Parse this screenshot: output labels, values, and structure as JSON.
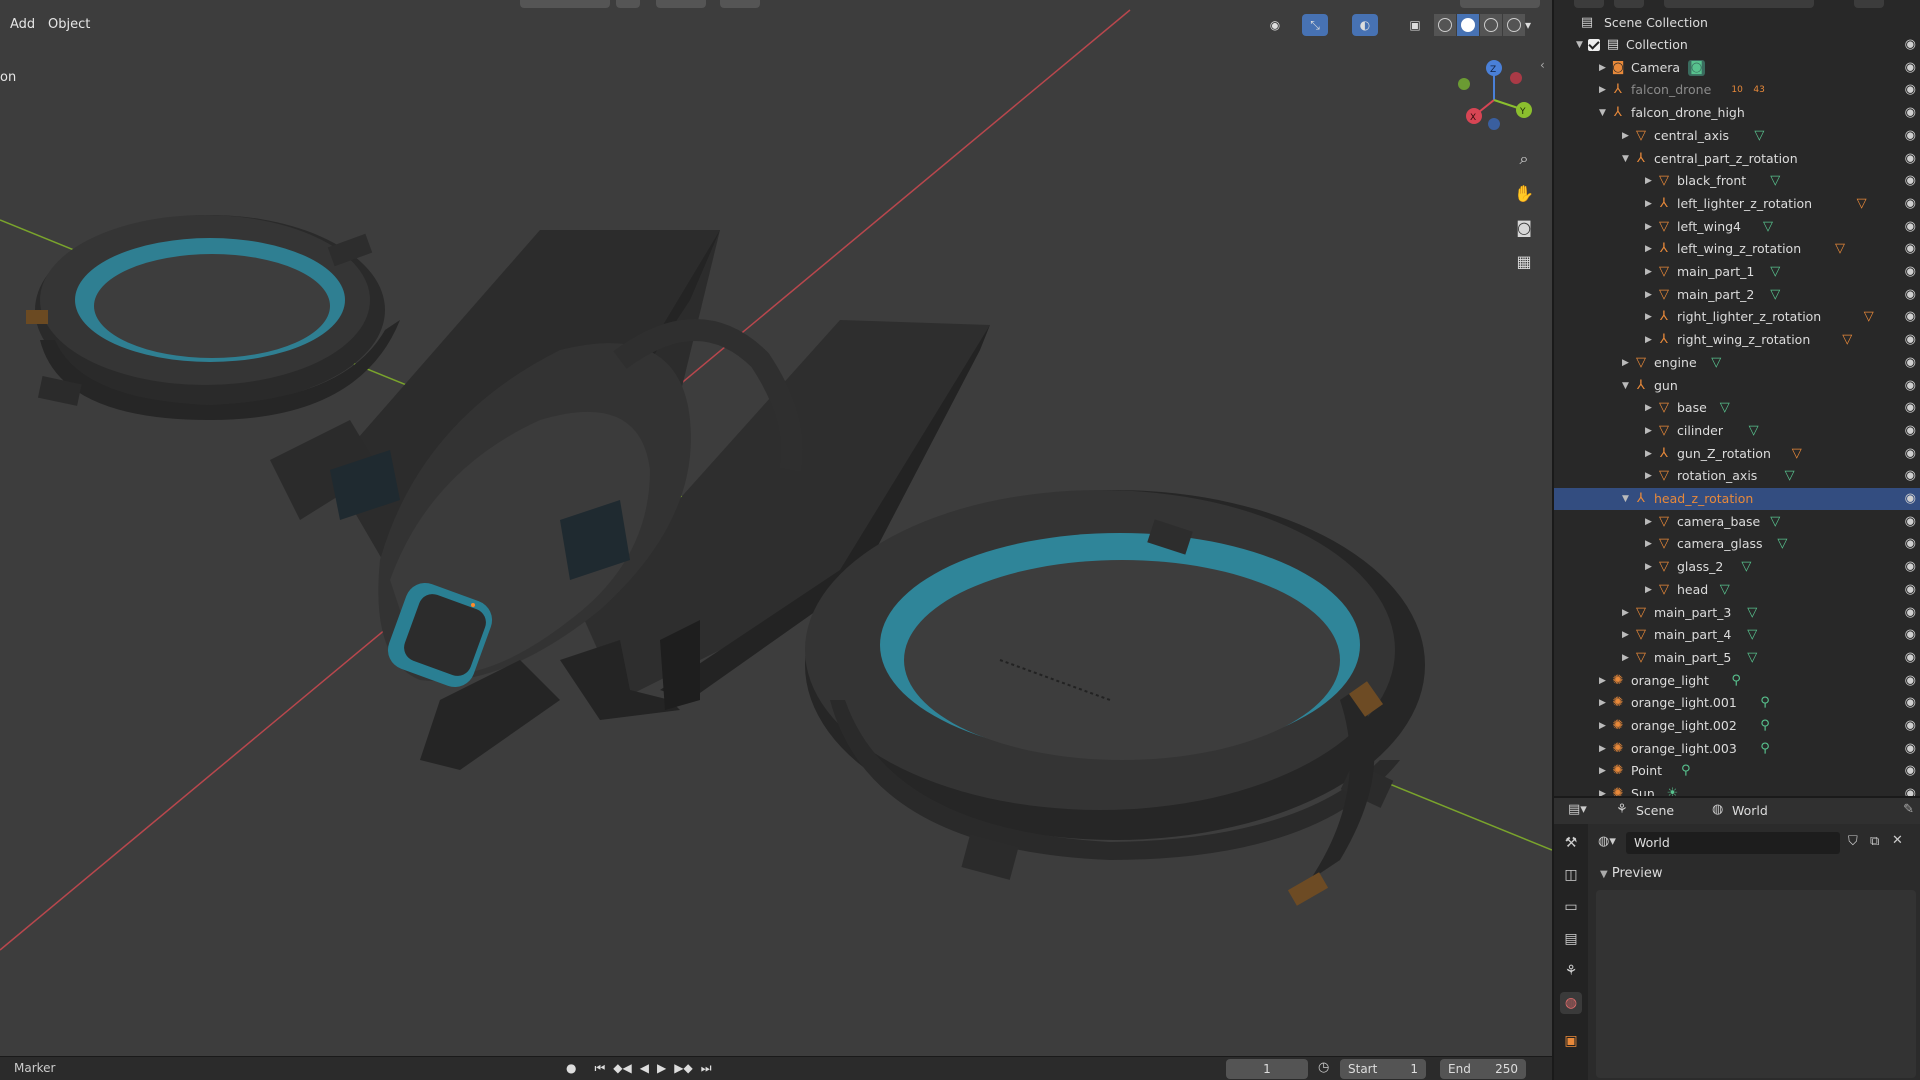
{
  "viewport": {
    "menu": [
      "Add",
      "Object"
    ],
    "side_label": "on"
  },
  "timeline": {
    "marker": "Marker",
    "current_frame": "1",
    "start_label": "Start",
    "start_value": "1",
    "end_label": "End",
    "end_value": "250"
  },
  "outliner": {
    "scene_collection": "Scene Collection",
    "rows": [
      {
        "name": "Collection",
        "type": "collection",
        "depth": 0,
        "expanded": true
      },
      {
        "name": "Camera",
        "type": "camera",
        "depth": 1,
        "expanded": false
      },
      {
        "name": "falcon_drone",
        "type": "empty",
        "depth": 1,
        "expanded": false,
        "dimmed": true
      },
      {
        "name": "falcon_drone_high",
        "type": "empty",
        "depth": 1,
        "expanded": true
      },
      {
        "name": "central_axis",
        "type": "mesh",
        "depth": 2,
        "expanded": false
      },
      {
        "name": "central_part_z_rotation",
        "type": "empty",
        "depth": 2,
        "expanded": true
      },
      {
        "name": "black_front",
        "type": "mesh",
        "depth": 3,
        "expanded": false
      },
      {
        "name": "left_lighter_z_rotation",
        "type": "empty",
        "depth": 3,
        "expanded": false
      },
      {
        "name": "left_wing4",
        "type": "mesh",
        "depth": 3,
        "expanded": false
      },
      {
        "name": "left_wing_z_rotation",
        "type": "empty",
        "depth": 3,
        "expanded": false
      },
      {
        "name": "main_part_1",
        "type": "mesh",
        "depth": 3,
        "expanded": false
      },
      {
        "name": "main_part_2",
        "type": "mesh",
        "depth": 3,
        "expanded": false
      },
      {
        "name": "right_lighter_z_rotation",
        "type": "empty",
        "depth": 3,
        "expanded": false
      },
      {
        "name": "right_wing_z_rotation",
        "type": "empty",
        "depth": 3,
        "expanded": false
      },
      {
        "name": "engine",
        "type": "mesh",
        "depth": 2,
        "expanded": false
      },
      {
        "name": "gun",
        "type": "empty",
        "depth": 2,
        "expanded": true
      },
      {
        "name": "base",
        "type": "mesh",
        "depth": 3,
        "expanded": false
      },
      {
        "name": "cilinder",
        "type": "mesh",
        "depth": 3,
        "expanded": false
      },
      {
        "name": "gun_Z_rotation",
        "type": "empty",
        "depth": 3,
        "expanded": false
      },
      {
        "name": "rotation_axis",
        "type": "mesh",
        "depth": 3,
        "expanded": false
      },
      {
        "name": "head_z_rotation",
        "type": "empty",
        "depth": 2,
        "expanded": true,
        "selected": true
      },
      {
        "name": "camera_base",
        "type": "mesh",
        "depth": 3,
        "expanded": false
      },
      {
        "name": "camera_glass",
        "type": "mesh",
        "depth": 3,
        "expanded": false
      },
      {
        "name": "glass_2",
        "type": "mesh",
        "depth": 3,
        "expanded": false
      },
      {
        "name": "head",
        "type": "mesh",
        "depth": 3,
        "expanded": false
      },
      {
        "name": "main_part_3",
        "type": "mesh",
        "depth": 2,
        "expanded": false
      },
      {
        "name": "main_part_4",
        "type": "mesh",
        "depth": 2,
        "expanded": false
      },
      {
        "name": "main_part_5",
        "type": "mesh",
        "depth": 2,
        "expanded": false
      },
      {
        "name": "orange_light",
        "type": "light",
        "depth": 1,
        "expanded": false
      },
      {
        "name": "orange_light.001",
        "type": "light",
        "depth": 1,
        "expanded": false
      },
      {
        "name": "orange_light.002",
        "type": "light",
        "depth": 1,
        "expanded": false
      },
      {
        "name": "orange_light.003",
        "type": "light",
        "depth": 1,
        "expanded": false
      },
      {
        "name": "Point",
        "type": "light",
        "depth": 1,
        "expanded": false
      },
      {
        "name": "Sun",
        "type": "sun",
        "depth": 1,
        "expanded": false
      }
    ],
    "badges": {
      "falcon_drone": [
        "10",
        "43"
      ]
    }
  },
  "properties": {
    "tabs": [
      "Scene",
      "World"
    ],
    "world_name": "World",
    "section": "Preview"
  },
  "colors": {
    "accent": "#4772b3",
    "selected_row": "#334d80",
    "object_orange": "#e8893a",
    "data_green": "#58c28e"
  }
}
